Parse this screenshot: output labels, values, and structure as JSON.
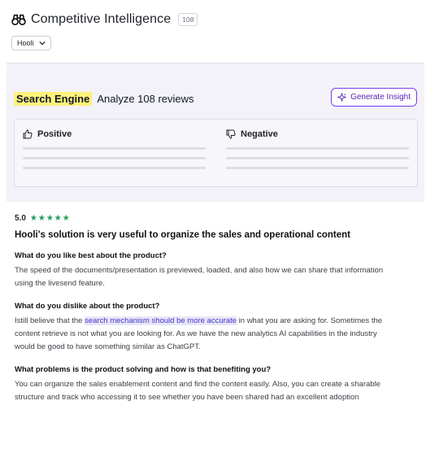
{
  "header": {
    "title": "Competitive Intelligence",
    "count": "108",
    "company": "Hooli"
  },
  "insight": {
    "category": "Search Engine",
    "analyze_text": "Analyze 108 reviews",
    "button_label": "Generate Insight",
    "positive_label": "Positive",
    "negative_label": "Negative"
  },
  "review": {
    "score": "5.0",
    "stars": "★★★★★",
    "title": "Hooli's solution is very useful to organize the sales and operational content",
    "q1": "What do you like best about the product?",
    "a1": "The speed of the documents/presentation is previewed, loaded, and also how we can share that information using the livesend feature.",
    "q2": "What do you dislike about the product?",
    "a2_before": "Istill believe that the ",
    "a2_highlight": "search mechanism should be more accurate",
    "a2_after": " in what you are asking for. Sometimes the content retrieve is not what you are looking for. As we have the new analytics AI capabilities in the industry would be good to have something similar as ChatGPT.",
    "q3": "What problems is the product solving and how is that benefiting you?",
    "a3": "You can organize the sales enablement content and find the content easily. Also, you can create a sharable structure and track who accessing it to see whether you have been shared had an excellent adoption"
  },
  "colors": {
    "accent": "#7c3aed",
    "highlight": "#fdf27a",
    "stars": "#1f9d55"
  }
}
